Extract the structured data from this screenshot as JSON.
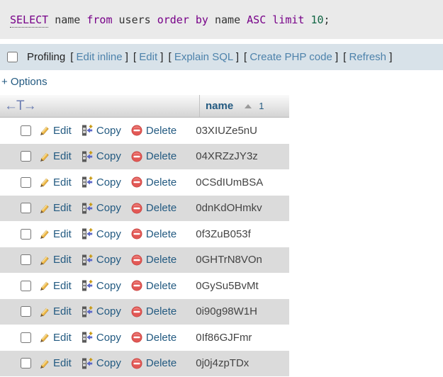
{
  "query": {
    "full_text": "SELECT name from users order by name ASC limit 10;",
    "tokens": [
      {
        "t": "SELECT",
        "c": "keyword",
        "u": true
      },
      {
        "t": " ",
        "c": "plain"
      },
      {
        "t": "name",
        "c": "plain"
      },
      {
        "t": " ",
        "c": "plain"
      },
      {
        "t": "from",
        "c": "keyword"
      },
      {
        "t": " ",
        "c": "plain"
      },
      {
        "t": "users",
        "c": "plain"
      },
      {
        "t": " ",
        "c": "plain"
      },
      {
        "t": "order",
        "c": "keyword"
      },
      {
        "t": " ",
        "c": "plain"
      },
      {
        "t": "by",
        "c": "keyword"
      },
      {
        "t": " ",
        "c": "plain"
      },
      {
        "t": "name",
        "c": "plain"
      },
      {
        "t": " ",
        "c": "plain"
      },
      {
        "t": "ASC",
        "c": "keyword"
      },
      {
        "t": " ",
        "c": "plain"
      },
      {
        "t": "limit",
        "c": "keyword"
      },
      {
        "t": " ",
        "c": "plain"
      },
      {
        "t": "10",
        "c": "number"
      },
      {
        "t": ";",
        "c": "plain"
      }
    ]
  },
  "profiling": {
    "label": "Profiling",
    "checkbox_checked": false,
    "links": [
      "Edit inline",
      "Edit",
      "Explain SQL",
      "Create PHP code",
      "Refresh"
    ]
  },
  "options": {
    "label": "+ Options"
  },
  "table": {
    "header": {
      "arrows": "←T→",
      "column": "name",
      "sort": "asc",
      "column_index": "1"
    },
    "row_actions": {
      "edit": "Edit",
      "copy": "Copy",
      "delete": "Delete"
    },
    "rows": [
      "03XIUZe5nU",
      "04XRZzJY3z",
      "0CSdIUmBSA",
      "0dnKdOHmkv",
      "0f3ZuB053f",
      "0GHTrN8VOn",
      "0GySu5BvMt",
      "0i90g98W1H",
      "0If86GJFmr",
      "0j0j4zpTDx"
    ]
  },
  "colors": {
    "query_bg": "#eaeaea",
    "keyword": "#770088",
    "number": "#116644",
    "profiling_bar_bg": "#d8e2e9",
    "toolbar_link": "#4d82ab",
    "table_link": "#235a81",
    "row_alt_bg": "#dbdbdb",
    "delete_icon": "#e25855",
    "pencil_icon": "#efb948",
    "arrows_icon": "#6a7cb1"
  }
}
